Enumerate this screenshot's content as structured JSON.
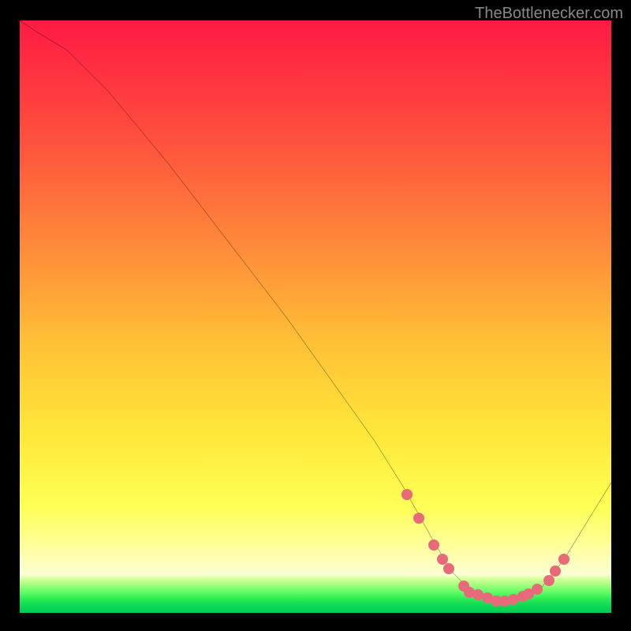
{
  "attribution": "TheBottlenecker.com",
  "chart_data": {
    "type": "line",
    "title": "",
    "xlabel": "",
    "ylabel": "",
    "xlim": [
      0,
      100
    ],
    "ylim": [
      0,
      100
    ],
    "curve": {
      "x": [
        0,
        3,
        8,
        15,
        25,
        35,
        45,
        55,
        60,
        65,
        70,
        73,
        76,
        80,
        84,
        88,
        92,
        100
      ],
      "y": [
        100,
        98,
        95,
        88,
        76,
        63,
        50,
        36,
        29,
        21,
        12,
        7,
        4,
        2,
        2,
        4,
        9,
        22
      ]
    },
    "dots": [
      {
        "x": 65.5,
        "y": 20
      },
      {
        "x": 67.5,
        "y": 16
      },
      {
        "x": 70.0,
        "y": 11.5
      },
      {
        "x": 71.5,
        "y": 9
      },
      {
        "x": 72.5,
        "y": 7.5
      },
      {
        "x": 75.0,
        "y": 4.5
      },
      {
        "x": 76.0,
        "y": 3.5
      },
      {
        "x": 77.5,
        "y": 3
      },
      {
        "x": 79.0,
        "y": 2.5
      },
      {
        "x": 80.5,
        "y": 2
      },
      {
        "x": 82.0,
        "y": 2
      },
      {
        "x": 83.5,
        "y": 2.3
      },
      {
        "x": 85.0,
        "y": 2.8
      },
      {
        "x": 86.0,
        "y": 3.2
      },
      {
        "x": 87.5,
        "y": 4
      },
      {
        "x": 89.5,
        "y": 5.5
      },
      {
        "x": 90.5,
        "y": 7
      },
      {
        "x": 92.0,
        "y": 9
      }
    ],
    "colors": {
      "gradient_top": "#ff1a44",
      "gradient_mid1": "#ff7a3a",
      "gradient_mid2": "#ffd633",
      "gradient_mid3": "#ffff66",
      "gradient_bottom_light": "#faffcc",
      "green_top": "#d4ff77",
      "green_mid": "#7aff73",
      "green_bottom": "#00dd66",
      "curve": "#000000",
      "dot": "#e86a7a"
    }
  }
}
